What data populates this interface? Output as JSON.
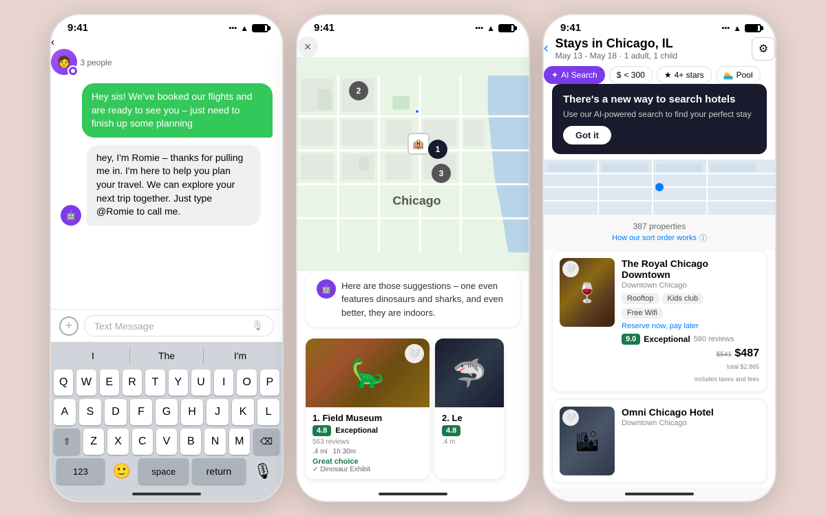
{
  "phone1": {
    "status_time": "9:41",
    "people_count": "3 people",
    "message_out": "Hey sis! We've booked our flights and are ready to see you – just need to finish up some planning",
    "message_in": "hey, I'm Romie – thanks for pulling me in. I'm here to help you plan your travel. We can explore your next trip together. Just type @Romie to call me.",
    "input_placeholder": "Text Message",
    "autocomplete": [
      "I",
      "The",
      "I'm"
    ],
    "keyboard_row1": [
      "Q",
      "W",
      "E",
      "R",
      "T",
      "Y",
      "U",
      "I",
      "O",
      "P"
    ],
    "keyboard_row2": [
      "A",
      "S",
      "D",
      "F",
      "G",
      "H",
      "J",
      "K",
      "L"
    ],
    "keyboard_row3": [
      "Z",
      "X",
      "C",
      "V",
      "B",
      "N",
      "M"
    ],
    "key_123": "123",
    "key_space": "space",
    "key_return": "return"
  },
  "phone2": {
    "status_time": "9:41",
    "chat_text": "Here are those suggestions – one even features dinosaurs and sharks, and even better, they are indoors.",
    "place1_num": "1. Field Museum",
    "place1_rating": "4.8",
    "place1_rating_label": "Exceptional",
    "place1_reviews": "563 reviews",
    "place1_dist": ".4 mi",
    "place1_time": "1h 30m",
    "place1_tag": "Great choice",
    "place1_exhibit": "Dinosaur Exhibit",
    "place2_num": "2. Le",
    "place2_rating": "4.8",
    "pin1": "2",
    "pin2": "1",
    "pin3": "3"
  },
  "phone3": {
    "status_time": "9:41",
    "title": "Stays in Chicago, IL",
    "subtitle": "May 13 - May 18  ·  1 adult, 1 child",
    "filter_ai": "AI Search",
    "filter_price": "< 300",
    "filter_stars": "4+ stars",
    "filter_pool": "Pool",
    "tooltip_title": "There's a new way to search hotels",
    "tooltip_text": "Use our AI-powered search to find your perfect stay",
    "tooltip_btn": "Got it",
    "properties_count": "387 properties",
    "sort_label": "How our sort order works",
    "hotel1_name": "The Royal Chicago Downtown",
    "hotel1_location": "Downtown Chicago",
    "hotel1_tag1": "Rooftop",
    "hotel1_tag2": "Kids club",
    "hotel1_tag3": "Free Wifi",
    "hotel1_reserve": "Reserve now, pay later",
    "hotel1_score": "9.0",
    "hotel1_rating_label": "Exceptional",
    "hotel1_reviews": "580 reviews",
    "hotel1_old_price": "$541",
    "hotel1_new_price": "$487",
    "hotel1_total": "total $2,865",
    "hotel1_fees": "includes taxes and fees",
    "hotel2_name": "Omni Chicago Hotel",
    "hotel2_location": "Downtown Chicago"
  }
}
